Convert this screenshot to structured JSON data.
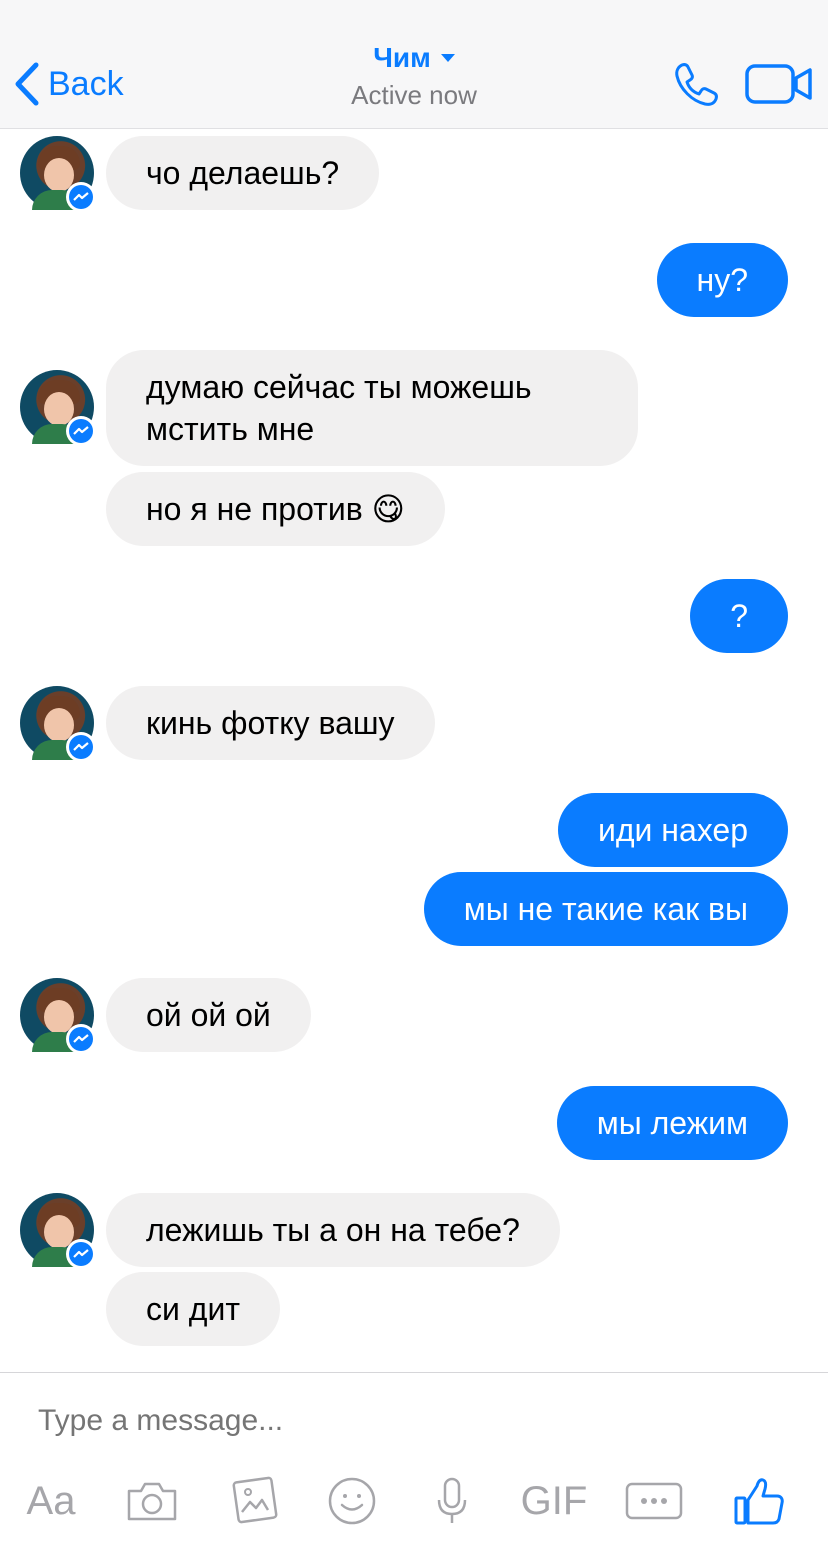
{
  "header": {
    "back_label": "Back",
    "contact_name": "Чим",
    "status": "Active now",
    "icons": [
      "chevron-left-icon",
      "phone-icon",
      "video-camera-icon"
    ]
  },
  "messages": [
    {
      "side": "in",
      "text": "чо делаешь?"
    },
    {
      "side": "out",
      "text": "ну?"
    },
    {
      "side": "in",
      "text": "думаю сейчас ты можешь мстить мне"
    },
    {
      "side": "in",
      "text": "но я не против 😋"
    },
    {
      "side": "out",
      "text": "?"
    },
    {
      "side": "in",
      "text": "кинь фотку вашу"
    },
    {
      "side": "out",
      "text": "иди нахер"
    },
    {
      "side": "out",
      "text": "мы не такие как вы"
    },
    {
      "side": "in",
      "text": "ой ой ой"
    },
    {
      "side": "out",
      "text": "мы лежим"
    },
    {
      "side": "in",
      "text": "лежишь ты а он на тебе?"
    },
    {
      "side": "in",
      "text": "си дит"
    }
  ],
  "composer": {
    "placeholder": "Type a message...",
    "aa_label": "Aa",
    "gif_label": "GIF",
    "icons": [
      "camera-icon",
      "gallery-icon",
      "emoji-icon",
      "microphone-icon",
      "more-icon",
      "like-icon"
    ]
  },
  "colors": {
    "accent": "#0a7cff",
    "incoming_bubble": "#f1f0f0",
    "icon_gray": "#a6a6aa"
  }
}
